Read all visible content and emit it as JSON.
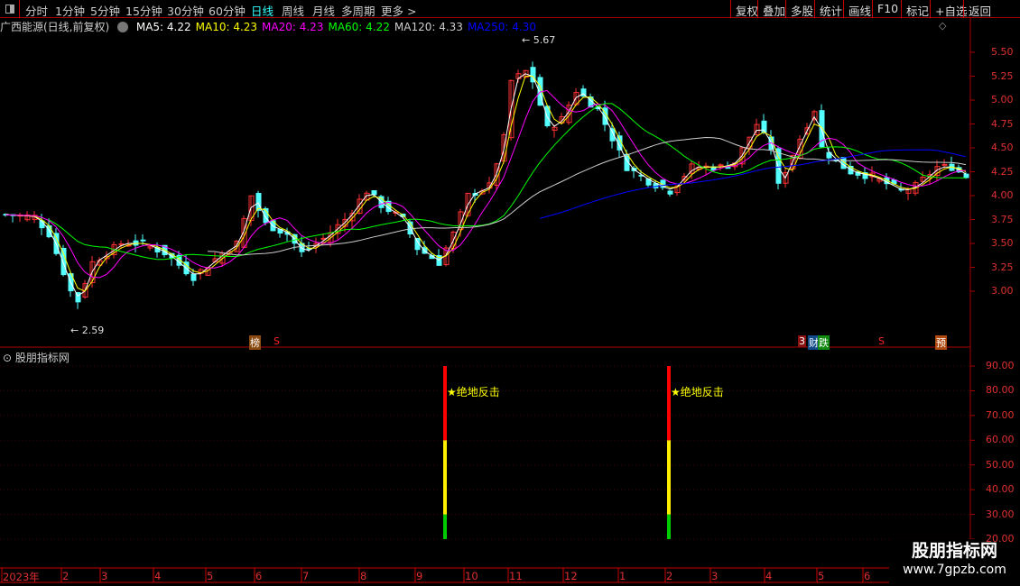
{
  "toolbar": {
    "periods": [
      "分时",
      "1分钟",
      "5分钟",
      "15分钟",
      "30分钟",
      "60分钟",
      "日线",
      "周线",
      "月线",
      "多周期",
      "更多 >"
    ],
    "active_period": "日线",
    "right_buttons": [
      "复权",
      "叠加",
      "多股",
      "统计",
      "画线",
      "F10",
      "标记",
      "+自选",
      "返回"
    ]
  },
  "info": {
    "title": "广西能源(日线,前复权)",
    "ma": [
      {
        "label": "MA5: 4.22",
        "color": "#ffffff"
      },
      {
        "label": "MA10: 4.23",
        "color": "#ffff00"
      },
      {
        "label": "MA20: 4.23",
        "color": "#ff00ff"
      },
      {
        "label": "MA60: 4.22",
        "color": "#00ff00"
      },
      {
        "label": "MA120: 4.33",
        "color": "#cccccc"
      },
      {
        "label": "MA250: 4.30",
        "color": "#0000ff"
      }
    ]
  },
  "price_axis": [
    "5.50",
    "5.25",
    "5.00",
    "4.75",
    "4.50",
    "4.25",
    "4.00",
    "3.75",
    "3.50",
    "3.25",
    "3.00"
  ],
  "annotations": {
    "high": "5.67",
    "low": "2.59"
  },
  "tags": [
    {
      "text": "榜",
      "bg": "#8a4a10"
    },
    {
      "text": "S",
      "bg": "none"
    },
    {
      "text": "3",
      "bg": "#8b1010"
    },
    {
      "text": "财",
      "bg": "#104a8a"
    },
    {
      "text": "跌",
      "bg": "#108a10"
    },
    {
      "text": "S",
      "bg": "none"
    },
    {
      "text": "预",
      "bg": "#b04a10"
    }
  ],
  "sub_panel": {
    "title": "股朋指标网",
    "axis": [
      "90.00",
      "80.00",
      "70.00",
      "60.00",
      "50.00",
      "40.00",
      "30.00",
      "20.00"
    ],
    "signal_label": "★绝地反击"
  },
  "time_axis": [
    "2023年",
    "2",
    "3",
    "4",
    "5",
    "6",
    "7",
    "8",
    "9",
    "10",
    "11",
    "12",
    "1",
    "2",
    "3",
    "4",
    "5",
    "6"
  ],
  "watermark": {
    "line1": "股朋指标网",
    "line2": "www.7gpzb.com"
  },
  "chart_data": {
    "type": "candlestick",
    "ylim": [
      2.5,
      5.7
    ],
    "close_anchors": [
      [
        0,
        3.8
      ],
      [
        4,
        3.78
      ],
      [
        6,
        3.6
      ],
      [
        9,
        3.0
      ],
      [
        10,
        2.9
      ],
      [
        12,
        3.3
      ],
      [
        16,
        3.5
      ],
      [
        19,
        3.5
      ],
      [
        22,
        3.4
      ],
      [
        26,
        3.15
      ],
      [
        30,
        3.4
      ],
      [
        32,
        3.5
      ],
      [
        34,
        4.0
      ],
      [
        36,
        3.7
      ],
      [
        39,
        3.6
      ],
      [
        41,
        3.4
      ],
      [
        44,
        3.55
      ],
      [
        47,
        3.75
      ],
      [
        50,
        4.05
      ],
      [
        52,
        3.9
      ],
      [
        55,
        3.75
      ],
      [
        57,
        3.45
      ],
      [
        60,
        3.3
      ],
      [
        62,
        3.6
      ],
      [
        64,
        4.0
      ],
      [
        67,
        4.1
      ],
      [
        69,
        4.6
      ],
      [
        70,
        5.2
      ],
      [
        72,
        5.3
      ],
      [
        73,
        5.2
      ],
      [
        75,
        4.7
      ],
      [
        77,
        4.8
      ],
      [
        79,
        5.1
      ],
      [
        82,
        4.9
      ],
      [
        84,
        4.6
      ],
      [
        86,
        4.3
      ],
      [
        89,
        4.15
      ],
      [
        92,
        4.05
      ],
      [
        95,
        4.3
      ],
      [
        99,
        4.3
      ],
      [
        101,
        4.35
      ],
      [
        104,
        4.75
      ],
      [
        106,
        4.5
      ],
      [
        107,
        4.1
      ],
      [
        110,
        4.6
      ],
      [
        112,
        4.9
      ],
      [
        113,
        4.5
      ],
      [
        115,
        4.35
      ],
      [
        117,
        4.25
      ],
      [
        120,
        4.2
      ],
      [
        124,
        4.05
      ],
      [
        126,
        4.1
      ],
      [
        129,
        4.3
      ],
      [
        131,
        4.3
      ],
      [
        133,
        4.2
      ]
    ],
    "signals": [
      {
        "bar": 61,
        "value": 90
      },
      {
        "bar": 92,
        "value": 90
      }
    ],
    "signal_bands": [
      {
        "from": 20,
        "to": 30,
        "color": "#00cc00"
      },
      {
        "from": 30,
        "to": 60,
        "color": "#ffee00"
      },
      {
        "from": 60,
        "to": 90,
        "color": "#ff0000"
      }
    ]
  }
}
